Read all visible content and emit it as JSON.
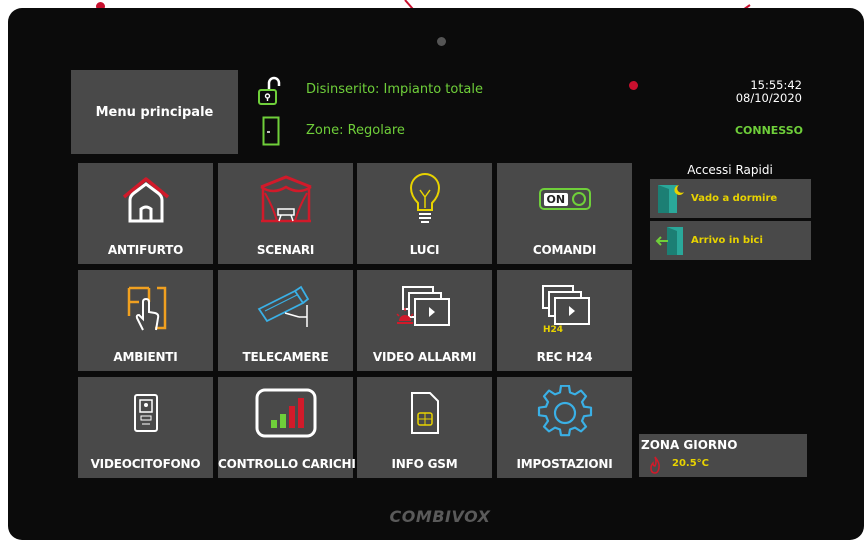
{
  "menu": {
    "label": "Menu principale"
  },
  "status": {
    "arm_state": "Disinserito: Impianto totale",
    "zones": "Zone: Regolare",
    "time": "15:55:42",
    "date": "08/10/2020",
    "connection": "CONNESSO"
  },
  "tiles": [
    {
      "label": "ANTIFURTO",
      "icon": "home-alarm-icon"
    },
    {
      "label": "SCENARI",
      "icon": "scenario-curtain-icon"
    },
    {
      "label": "LUCI",
      "icon": "lightbulb-icon"
    },
    {
      "label": "COMANDI",
      "icon": "on-switch-icon"
    },
    {
      "label": "AMBIENTI",
      "icon": "room-touch-icon"
    },
    {
      "label": "TELECAMERE",
      "icon": "camera-icon"
    },
    {
      "label": "VIDEO ALLARMI",
      "icon": "video-alarm-icon"
    },
    {
      "label": "REC H24",
      "icon": "rec-h24-icon"
    },
    {
      "label": "VIDEOCITOFONO",
      "icon": "video-intercom-icon"
    },
    {
      "label": "CONTROLLO CARICHI",
      "icon": "load-control-icon"
    },
    {
      "label": "INFO GSM",
      "icon": "sim-card-icon"
    },
    {
      "label": "IMPOSTAZIONI",
      "icon": "settings-gear-icon"
    }
  ],
  "switch_text": "ON",
  "rec_badge": "H24",
  "quick_access": {
    "title": "Accessi Rapidi",
    "items": [
      {
        "label": "Vado a dormire",
        "icon": "door-moon-icon"
      },
      {
        "label": "Arrivo in bici",
        "icon": "door-enter-icon"
      }
    ]
  },
  "zone": {
    "name": "ZONA GIORNO",
    "temperature": "20.5°C"
  },
  "brand": "COMBIVOX",
  "colors": {
    "accent_green": "#6fcf3a",
    "accent_yellow": "#e8d300",
    "accent_red": "#d11a2a",
    "accent_blue": "#3ab0e6",
    "accent_orange": "#f0a020",
    "tile_bg": "#494949"
  }
}
